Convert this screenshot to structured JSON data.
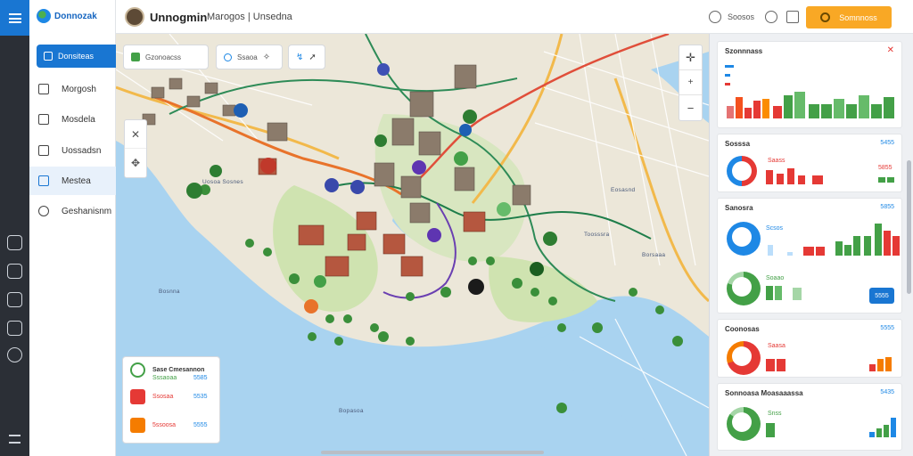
{
  "app": {
    "brand": "Donnozak",
    "title": "Unnogmin",
    "breadcrumb": "Marogos | Unsedna"
  },
  "sidebar": {
    "primary_button": "Donsiteas",
    "items": [
      {
        "label": "Morgosh",
        "icon": "calendar-icon"
      },
      {
        "label": "Mosdela",
        "icon": "chart-icon"
      },
      {
        "label": "Uossadsn",
        "icon": "document-icon"
      },
      {
        "label": "Mestea",
        "icon": "grid-icon"
      },
      {
        "label": "Geshanisnm",
        "icon": "clock-icon"
      }
    ]
  },
  "header": {
    "search_label": "Soosos",
    "cta_label": "Somnnoss"
  },
  "map": {
    "chips": [
      "Gzonoacss",
      "Ssaoa",
      ""
    ],
    "legend": {
      "title": "Sase Cmesannon",
      "rows": [
        {
          "label": "Sssaoaa",
          "value": "5585",
          "color": "#43a047"
        },
        {
          "label": "Ssosaa",
          "value": "5535",
          "color": "#e53935"
        },
        {
          "label": "5ssoosa",
          "value": "5555",
          "color": "#f57c00"
        }
      ]
    },
    "place_labels": [
      "Bosnna",
      "Bopasoa",
      "Eosasnd",
      "Toosssra",
      "Borsaaa",
      "Uosoa Sosnes"
    ]
  },
  "panel": {
    "cards": [
      {
        "title": "Szonnnass",
        "meta": ""
      },
      {
        "title": "Sosssa",
        "meta": "5455"
      },
      {
        "title": "Sanosra",
        "meta": "5855"
      },
      {
        "title": "Coonosas",
        "meta": "5555"
      },
      {
        "title": "Sonnoasa Moasaaassa",
        "meta": "5435"
      }
    ],
    "sub_labels": {
      "card2_a": "Saass",
      "card2_b": "5855",
      "card3_a": "Scsos",
      "card3_b": "Soaao",
      "card3_btn": "5555",
      "card4_a": "Saasa",
      "card5_a": "Snss"
    }
  },
  "colors": {
    "primary": "#1976d2",
    "accent": "#f9a825",
    "green": "#43a047",
    "red": "#e53935",
    "orange": "#f57c00"
  }
}
